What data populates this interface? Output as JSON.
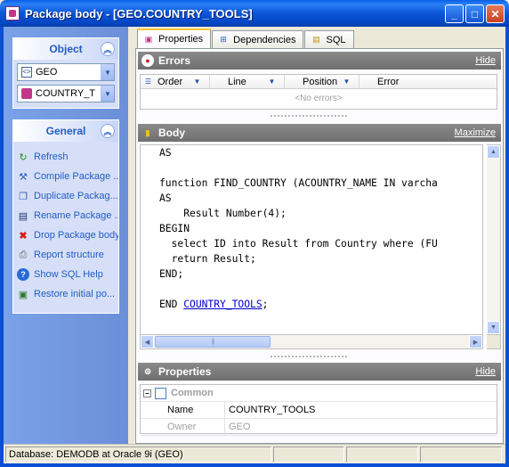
{
  "window": {
    "title": "Package body - [GEO.COUNTRY_TOOLS]",
    "minimize_label": "_",
    "maximize_label": "□",
    "close_label": "✕"
  },
  "object_panel": {
    "header": "Object",
    "schema_combo": {
      "value": "GEO"
    },
    "object_combo": {
      "value": "COUNTRY_T"
    }
  },
  "general_panel": {
    "header": "General",
    "items": [
      {
        "label": "Refresh",
        "icon": "refresh-icon"
      },
      {
        "label": "Compile Package ...",
        "icon": "compile-icon"
      },
      {
        "label": "Duplicate Packag...",
        "icon": "duplicate-icon"
      },
      {
        "label": "Rename Package ...",
        "icon": "rename-icon"
      },
      {
        "label": "Drop Package body",
        "icon": "drop-icon"
      },
      {
        "label": "Report structure",
        "icon": "report-icon"
      },
      {
        "label": "Show SQL Help",
        "icon": "help-icon"
      },
      {
        "label": "Restore initial po...",
        "icon": "restore-icon"
      }
    ]
  },
  "tabs": [
    {
      "label": "Properties",
      "active": true
    },
    {
      "label": "Dependencies",
      "active": false
    },
    {
      "label": "SQL",
      "active": false
    }
  ],
  "errors": {
    "title": "Errors",
    "hide_link": "Hide",
    "columns": [
      "Order",
      "Line",
      "Position",
      "Error"
    ],
    "empty_text": "<No errors>"
  },
  "body": {
    "title": "Body",
    "maximize_link": "Maximize",
    "code_lines": [
      "AS",
      "",
      "function FIND_COUNTRY (ACOUNTRY_NAME IN varcha",
      "AS",
      "    Result Number(4);",
      "BEGIN",
      "  select ID into Result from Country where (FU",
      "  return Result;",
      "END;",
      "",
      "END "
    ],
    "end_link": "COUNTRY_TOOLS",
    "end_suffix": ";"
  },
  "properties": {
    "title": "Properties",
    "hide_link": "Hide",
    "category": "Common",
    "rows": [
      {
        "name": "Name",
        "value": "COUNTRY_TOOLS",
        "dim": false
      },
      {
        "name": "Owner",
        "value": "GEO",
        "dim": true
      }
    ]
  },
  "status": {
    "text": "Database: DEMODB  at Oracle 9i (GEO)"
  }
}
